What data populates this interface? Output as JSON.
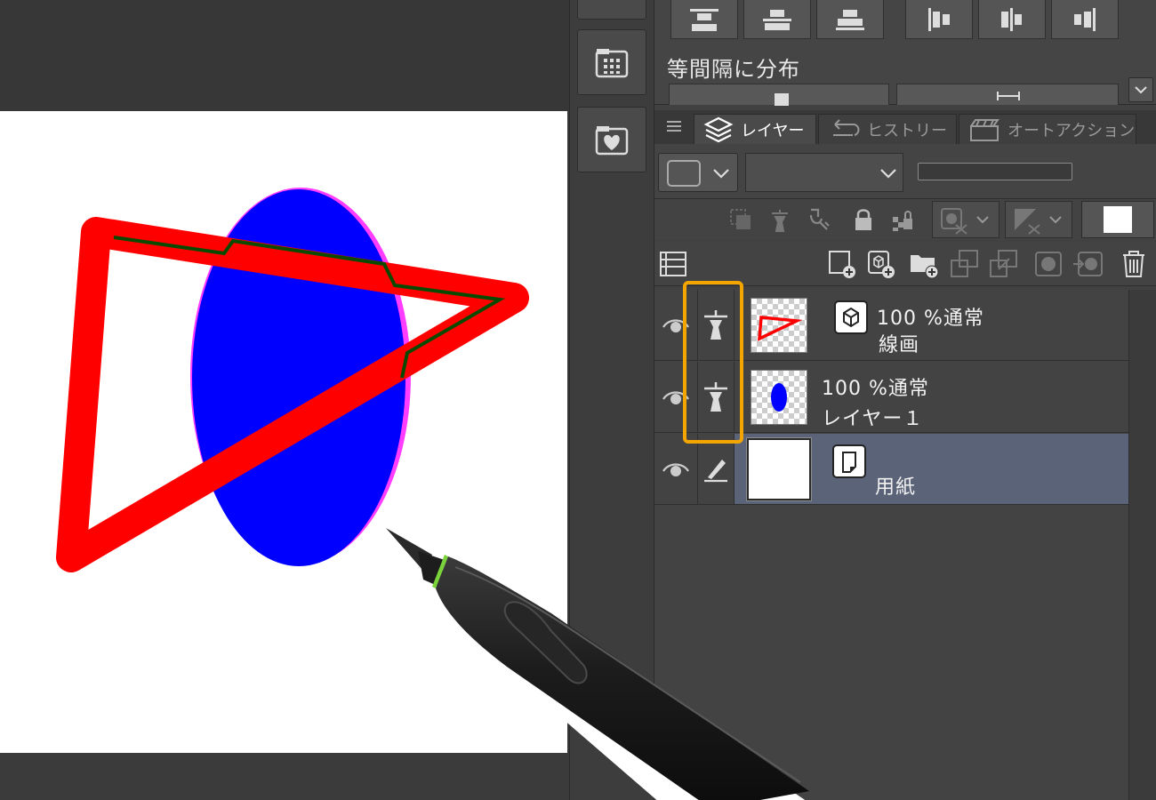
{
  "align_panel": {
    "distribute_label": "等間隔に分布"
  },
  "tabs": [
    {
      "label": "レイヤー",
      "icon": "layers-icon",
      "active": true
    },
    {
      "label": "ヒストリー",
      "icon": "history-icon",
      "active": false
    },
    {
      "label": "オートアクション",
      "icon": "auto-action-icon",
      "active": false
    }
  ],
  "layers": [
    {
      "blend": "100 %通常",
      "name": "線画",
      "type_icon": "vector-layer-icon",
      "state_icon": "reference-layer-icon",
      "selected": false
    },
    {
      "blend": "100 %通常",
      "name": "レイヤー１",
      "type_icon": "",
      "state_icon": "reference-layer-icon",
      "selected": false
    },
    {
      "blend": "",
      "name": "用紙",
      "type_icon": "paper-layer-icon",
      "state_icon": "pen-edit-icon",
      "selected": true
    }
  ],
  "colors": {
    "highlight": "#f5a500",
    "stroke_red": "#ff0000",
    "fill_blue": "#0000ff",
    "selected_row": "#5b6378"
  }
}
